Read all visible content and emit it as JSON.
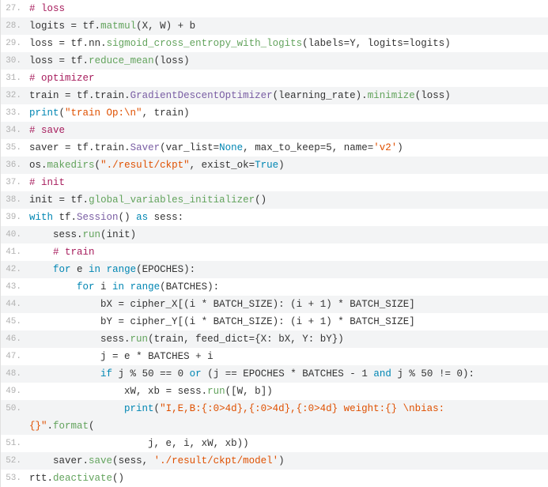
{
  "lines": [
    {
      "n": "27.",
      "bg": "odd",
      "tokens": [
        [
          "comment",
          "# loss"
        ]
      ]
    },
    {
      "n": "28.",
      "bg": "even",
      "tokens": [
        [
          "name",
          "logits "
        ],
        [
          "op",
          "="
        ],
        [
          "name",
          " tf"
        ],
        [
          "punc",
          "."
        ],
        [
          "func",
          "matmul"
        ],
        [
          "punc",
          "("
        ],
        [
          "name",
          "X"
        ],
        [
          "punc",
          ", "
        ],
        [
          "name",
          "W"
        ],
        [
          "punc",
          ") "
        ],
        [
          "op",
          "+"
        ],
        [
          "name",
          " b"
        ]
      ]
    },
    {
      "n": "29.",
      "bg": "odd",
      "tokens": [
        [
          "name",
          "loss "
        ],
        [
          "op",
          "="
        ],
        [
          "name",
          " tf"
        ],
        [
          "punc",
          "."
        ],
        [
          "name",
          "nn"
        ],
        [
          "punc",
          "."
        ],
        [
          "func",
          "sigmoid_cross_entropy_with_logits"
        ],
        [
          "punc",
          "("
        ],
        [
          "name",
          "labels"
        ],
        [
          "op",
          "="
        ],
        [
          "name",
          "Y"
        ],
        [
          "punc",
          ", "
        ],
        [
          "name",
          "logits"
        ],
        [
          "op",
          "="
        ],
        [
          "name",
          "logits"
        ],
        [
          "punc",
          ")"
        ]
      ]
    },
    {
      "n": "30.",
      "bg": "even",
      "tokens": [
        [
          "name",
          "loss "
        ],
        [
          "op",
          "="
        ],
        [
          "name",
          " tf"
        ],
        [
          "punc",
          "."
        ],
        [
          "func",
          "reduce_mean"
        ],
        [
          "punc",
          "("
        ],
        [
          "name",
          "loss"
        ],
        [
          "punc",
          ")"
        ]
      ]
    },
    {
      "n": "31.",
      "bg": "odd",
      "tokens": [
        [
          "comment",
          "# optimizer"
        ]
      ]
    },
    {
      "n": "32.",
      "bg": "even",
      "tokens": [
        [
          "name",
          "train "
        ],
        [
          "op",
          "="
        ],
        [
          "name",
          " tf"
        ],
        [
          "punc",
          "."
        ],
        [
          "name",
          "train"
        ],
        [
          "punc",
          "."
        ],
        [
          "class",
          "GradientDescentOptimizer"
        ],
        [
          "punc",
          "("
        ],
        [
          "name",
          "learning_rate"
        ],
        [
          "punc",
          ")."
        ],
        [
          "func",
          "minimize"
        ],
        [
          "punc",
          "("
        ],
        [
          "name",
          "loss"
        ],
        [
          "punc",
          ")"
        ]
      ]
    },
    {
      "n": "33.",
      "bg": "odd",
      "tokens": [
        [
          "builtin",
          "print"
        ],
        [
          "punc",
          "("
        ],
        [
          "string",
          "\"train Op:\\n\""
        ],
        [
          "punc",
          ", "
        ],
        [
          "name",
          "train"
        ],
        [
          "punc",
          ")"
        ]
      ]
    },
    {
      "n": "34.",
      "bg": "even",
      "tokens": [
        [
          "comment",
          "# save"
        ]
      ]
    },
    {
      "n": "35.",
      "bg": "odd",
      "tokens": [
        [
          "name",
          "saver "
        ],
        [
          "op",
          "="
        ],
        [
          "name",
          " tf"
        ],
        [
          "punc",
          "."
        ],
        [
          "name",
          "train"
        ],
        [
          "punc",
          "."
        ],
        [
          "class",
          "Saver"
        ],
        [
          "punc",
          "("
        ],
        [
          "name",
          "var_list"
        ],
        [
          "op",
          "="
        ],
        [
          "const",
          "None"
        ],
        [
          "punc",
          ", "
        ],
        [
          "name",
          "max_to_keep"
        ],
        [
          "op",
          "="
        ],
        [
          "number",
          "5"
        ],
        [
          "punc",
          ", "
        ],
        [
          "name",
          "name"
        ],
        [
          "op",
          "="
        ],
        [
          "string",
          "'v2'"
        ],
        [
          "punc",
          ")"
        ]
      ]
    },
    {
      "n": "36.",
      "bg": "even",
      "tokens": [
        [
          "name",
          "os"
        ],
        [
          "punc",
          "."
        ],
        [
          "func",
          "makedirs"
        ],
        [
          "punc",
          "("
        ],
        [
          "string",
          "\"./result/ckpt\""
        ],
        [
          "punc",
          ", "
        ],
        [
          "name",
          "exist_ok"
        ],
        [
          "op",
          "="
        ],
        [
          "const",
          "True"
        ],
        [
          "punc",
          ")"
        ]
      ]
    },
    {
      "n": "37.",
      "bg": "odd",
      "tokens": [
        [
          "comment",
          "# init"
        ]
      ]
    },
    {
      "n": "38.",
      "bg": "even",
      "tokens": [
        [
          "name",
          "init "
        ],
        [
          "op",
          "="
        ],
        [
          "name",
          " tf"
        ],
        [
          "punc",
          "."
        ],
        [
          "func",
          "global_variables_initializer"
        ],
        [
          "punc",
          "()"
        ]
      ]
    },
    {
      "n": "39.",
      "bg": "odd",
      "tokens": [
        [
          "keyword",
          "with"
        ],
        [
          "name",
          " tf"
        ],
        [
          "punc",
          "."
        ],
        [
          "class",
          "Session"
        ],
        [
          "punc",
          "() "
        ],
        [
          "keyword",
          "as"
        ],
        [
          "name",
          " sess"
        ],
        [
          "punc",
          ":"
        ]
      ]
    },
    {
      "n": "40.",
      "bg": "even",
      "tokens": [
        [
          "name",
          "    sess"
        ],
        [
          "punc",
          "."
        ],
        [
          "func",
          "run"
        ],
        [
          "punc",
          "("
        ],
        [
          "name",
          "init"
        ],
        [
          "punc",
          ")"
        ]
      ]
    },
    {
      "n": "41.",
      "bg": "odd",
      "tokens": [
        [
          "comment",
          "    # train"
        ]
      ]
    },
    {
      "n": "42.",
      "bg": "even",
      "tokens": [
        [
          "name",
          "    "
        ],
        [
          "keyword",
          "for"
        ],
        [
          "name",
          " e "
        ],
        [
          "keyword",
          "in"
        ],
        [
          "name",
          " "
        ],
        [
          "builtin",
          "range"
        ],
        [
          "punc",
          "("
        ],
        [
          "name",
          "EPOCHES"
        ],
        [
          "punc",
          "):"
        ]
      ]
    },
    {
      "n": "43.",
      "bg": "odd",
      "tokens": [
        [
          "name",
          "        "
        ],
        [
          "keyword",
          "for"
        ],
        [
          "name",
          " i "
        ],
        [
          "keyword",
          "in"
        ],
        [
          "name",
          " "
        ],
        [
          "builtin",
          "range"
        ],
        [
          "punc",
          "("
        ],
        [
          "name",
          "BATCHES"
        ],
        [
          "punc",
          "):"
        ]
      ]
    },
    {
      "n": "44.",
      "bg": "even",
      "tokens": [
        [
          "name",
          "            bX "
        ],
        [
          "op",
          "="
        ],
        [
          "name",
          " cipher_X"
        ],
        [
          "punc",
          "[("
        ],
        [
          "name",
          "i "
        ],
        [
          "op",
          "*"
        ],
        [
          "name",
          " BATCH_SIZE"
        ],
        [
          "punc",
          "): ("
        ],
        [
          "name",
          "i "
        ],
        [
          "op",
          "+"
        ],
        [
          "name",
          " "
        ],
        [
          "number",
          "1"
        ],
        [
          "punc",
          ") "
        ],
        [
          "op",
          "*"
        ],
        [
          "name",
          " BATCH_SIZE"
        ],
        [
          "punc",
          "]"
        ]
      ]
    },
    {
      "n": "45.",
      "bg": "odd",
      "tokens": [
        [
          "name",
          "            bY "
        ],
        [
          "op",
          "="
        ],
        [
          "name",
          " cipher_Y"
        ],
        [
          "punc",
          "[("
        ],
        [
          "name",
          "i "
        ],
        [
          "op",
          "*"
        ],
        [
          "name",
          " BATCH_SIZE"
        ],
        [
          "punc",
          "): ("
        ],
        [
          "name",
          "i "
        ],
        [
          "op",
          "+"
        ],
        [
          "name",
          " "
        ],
        [
          "number",
          "1"
        ],
        [
          "punc",
          ") "
        ],
        [
          "op",
          "*"
        ],
        [
          "name",
          " BATCH_SIZE"
        ],
        [
          "punc",
          "]"
        ]
      ]
    },
    {
      "n": "46.",
      "bg": "even",
      "tokens": [
        [
          "name",
          "            sess"
        ],
        [
          "punc",
          "."
        ],
        [
          "func",
          "run"
        ],
        [
          "punc",
          "("
        ],
        [
          "name",
          "train"
        ],
        [
          "punc",
          ", "
        ],
        [
          "name",
          "feed_dict"
        ],
        [
          "op",
          "="
        ],
        [
          "punc",
          "{"
        ],
        [
          "name",
          "X"
        ],
        [
          "punc",
          ": "
        ],
        [
          "name",
          "bX"
        ],
        [
          "punc",
          ", "
        ],
        [
          "name",
          "Y"
        ],
        [
          "punc",
          ": "
        ],
        [
          "name",
          "bY"
        ],
        [
          "punc",
          "})"
        ]
      ]
    },
    {
      "n": "47.",
      "bg": "odd",
      "tokens": [
        [
          "name",
          "            j "
        ],
        [
          "op",
          "="
        ],
        [
          "name",
          " e "
        ],
        [
          "op",
          "*"
        ],
        [
          "name",
          " BATCHES "
        ],
        [
          "op",
          "+"
        ],
        [
          "name",
          " i"
        ]
      ]
    },
    {
      "n": "48.",
      "bg": "even",
      "tokens": [
        [
          "name",
          "            "
        ],
        [
          "keyword",
          "if"
        ],
        [
          "name",
          " j "
        ],
        [
          "op",
          "%"
        ],
        [
          "name",
          " "
        ],
        [
          "number",
          "50"
        ],
        [
          "name",
          " "
        ],
        [
          "op",
          "=="
        ],
        [
          "name",
          " "
        ],
        [
          "number",
          "0"
        ],
        [
          "name",
          " "
        ],
        [
          "keyword",
          "or"
        ],
        [
          "name",
          " "
        ],
        [
          "punc",
          "("
        ],
        [
          "name",
          "j "
        ],
        [
          "op",
          "=="
        ],
        [
          "name",
          " EPOCHES "
        ],
        [
          "op",
          "*"
        ],
        [
          "name",
          " BATCHES "
        ],
        [
          "op",
          "-"
        ],
        [
          "name",
          " "
        ],
        [
          "number",
          "1"
        ],
        [
          "name",
          " "
        ],
        [
          "keyword",
          "and"
        ],
        [
          "name",
          " j "
        ],
        [
          "op",
          "%"
        ],
        [
          "name",
          " "
        ],
        [
          "number",
          "50"
        ],
        [
          "name",
          " "
        ],
        [
          "op",
          "!="
        ],
        [
          "name",
          " "
        ],
        [
          "number",
          "0"
        ],
        [
          "punc",
          "):"
        ]
      ]
    },
    {
      "n": "49.",
      "bg": "odd",
      "tokens": [
        [
          "name",
          "                xW"
        ],
        [
          "punc",
          ", "
        ],
        [
          "name",
          "xb "
        ],
        [
          "op",
          "="
        ],
        [
          "name",
          " sess"
        ],
        [
          "punc",
          "."
        ],
        [
          "func",
          "run"
        ],
        [
          "punc",
          "(["
        ],
        [
          "name",
          "W"
        ],
        [
          "punc",
          ", "
        ],
        [
          "name",
          "b"
        ],
        [
          "punc",
          "])"
        ]
      ]
    },
    {
      "n": "50.",
      "bg": "even",
      "tokens": [
        [
          "name",
          "                "
        ],
        [
          "builtin",
          "print"
        ],
        [
          "punc",
          "("
        ],
        [
          "string",
          "\"I,E,B:{:0>4d},{:0>4d},{:0>4d} weight:{} \\nbias:"
        ]
      ]
    },
    {
      "n": "",
      "bg": "even",
      "tokens": [
        [
          "string",
          "{}\""
        ],
        [
          "punc",
          "."
        ],
        [
          "func",
          "format"
        ],
        [
          "punc",
          "("
        ]
      ]
    },
    {
      "n": "51.",
      "bg": "odd",
      "tokens": [
        [
          "name",
          "                    j"
        ],
        [
          "punc",
          ", "
        ],
        [
          "name",
          "e"
        ],
        [
          "punc",
          ", "
        ],
        [
          "name",
          "i"
        ],
        [
          "punc",
          ", "
        ],
        [
          "name",
          "xW"
        ],
        [
          "punc",
          ", "
        ],
        [
          "name",
          "xb"
        ],
        [
          "punc",
          "))"
        ]
      ]
    },
    {
      "n": "52.",
      "bg": "even",
      "tokens": [
        [
          "name",
          "    saver"
        ],
        [
          "punc",
          "."
        ],
        [
          "func",
          "save"
        ],
        [
          "punc",
          "("
        ],
        [
          "name",
          "sess"
        ],
        [
          "punc",
          ", "
        ],
        [
          "string",
          "'./result/ckpt/model'"
        ],
        [
          "punc",
          ")"
        ]
      ]
    },
    {
      "n": "53.",
      "bg": "odd",
      "tokens": [
        [
          "name",
          "rtt"
        ],
        [
          "punc",
          "."
        ],
        [
          "func",
          "deactivate"
        ],
        [
          "punc",
          "()"
        ]
      ]
    }
  ],
  "token_classes": {
    "comment": "tok-comment",
    "keyword": "tok-keyword",
    "builtin": "tok-builtin",
    "func": "tok-func",
    "class": "tok-class",
    "string": "tok-string",
    "number": "tok-number",
    "op": "tok-op",
    "const": "tok-const",
    "name": "tok-name",
    "punc": "tok-punc"
  }
}
